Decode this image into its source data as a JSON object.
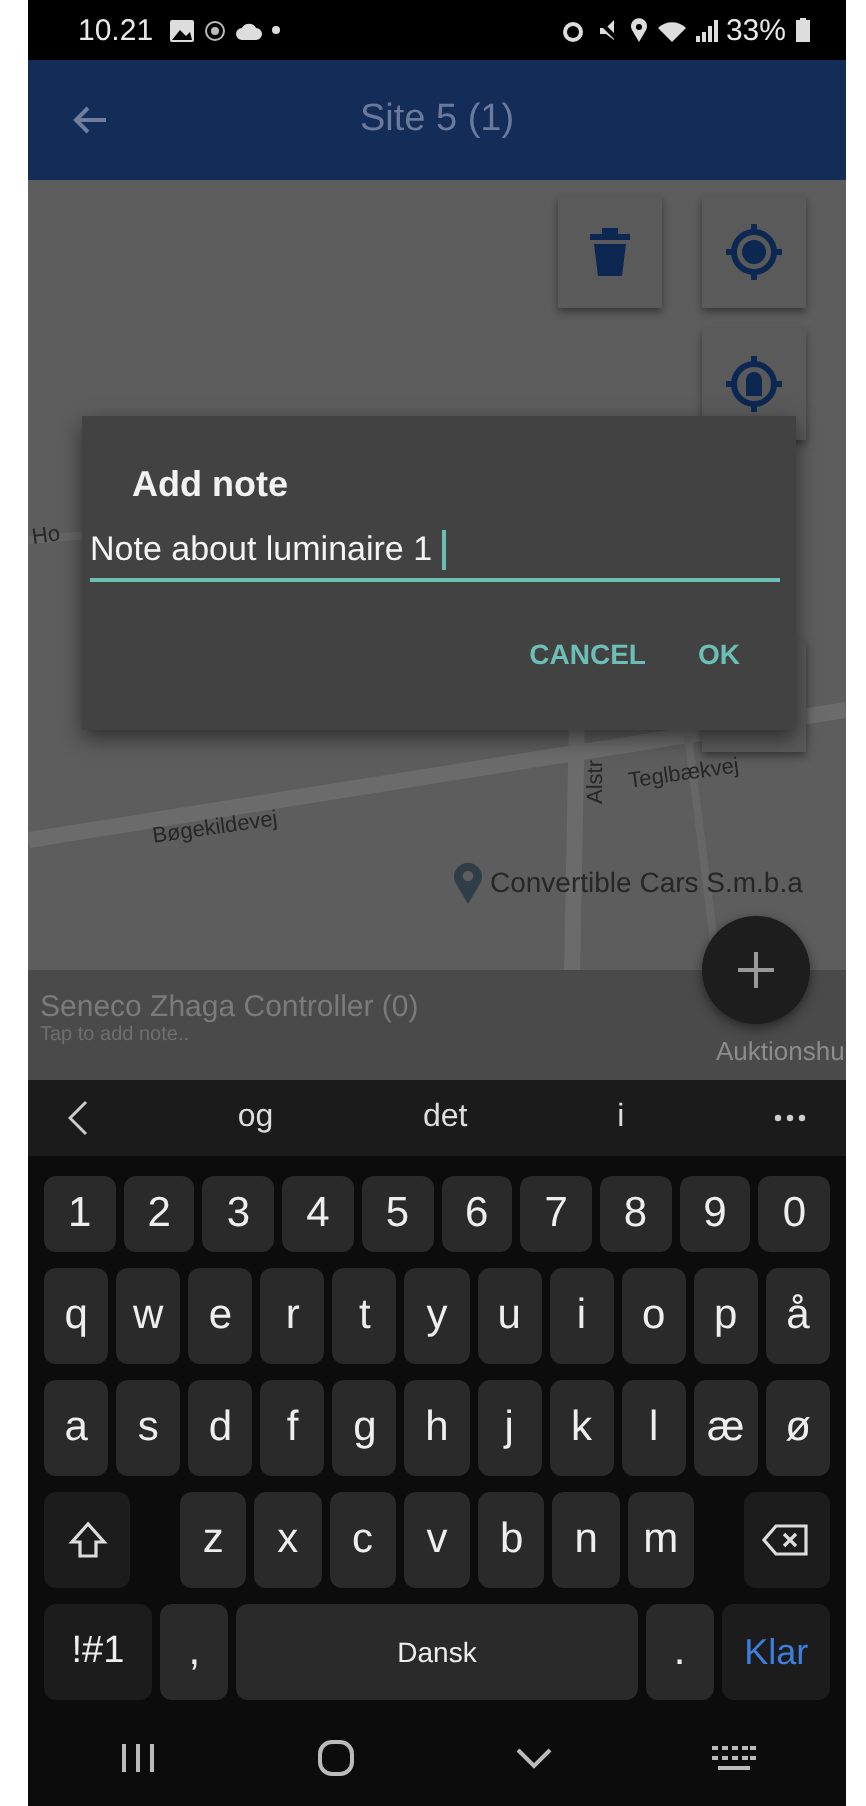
{
  "status_bar": {
    "time": "10.21",
    "battery": "33%"
  },
  "app_bar": {
    "title": "Site 5 (1)"
  },
  "map": {
    "labels": [
      {
        "kind": "street",
        "text": "Ho"
      },
      {
        "kind": "street-vertical",
        "text": "Alstr"
      },
      {
        "kind": "street",
        "text": "Teglbækvej"
      },
      {
        "kind": "street",
        "text": "Bøgekildevej"
      },
      {
        "kind": "place",
        "text": "Convertible Cars S.m.b.a"
      },
      {
        "kind": "street",
        "text": "Auktionshu"
      }
    ]
  },
  "dialog": {
    "title": "Add note",
    "field_value": "Note about luminaire 1",
    "buttons": [
      "CANCEL",
      "OK"
    ]
  },
  "bottom_sheet": {
    "title": "Seneco Zhaga Controller (0)",
    "subtitle": "Tap to add note.."
  },
  "keyboard": {
    "suggestions": [
      "og",
      "det",
      "i"
    ],
    "number_row": [
      "1",
      "2",
      "3",
      "4",
      "5",
      "6",
      "7",
      "8",
      "9",
      "0"
    ],
    "letter_rows": [
      [
        "q",
        "w",
        "e",
        "r",
        "t",
        "y",
        "u",
        "i",
        "o",
        "p",
        "å"
      ],
      [
        "a",
        "s",
        "d",
        "f",
        "g",
        "h",
        "j",
        "k",
        "l",
        "æ",
        "ø"
      ]
    ],
    "z_row": [
      "z",
      "x",
      "c",
      "v",
      "b",
      "n",
      "m"
    ],
    "bottom_row": [
      {
        "kind": "symbols",
        "label": "!#1"
      },
      {
        "kind": "comma",
        "label": ","
      },
      {
        "kind": "space",
        "label": "Dansk"
      },
      {
        "kind": "period",
        "label": "."
      },
      {
        "kind": "enter",
        "label": "Klar"
      }
    ]
  }
}
